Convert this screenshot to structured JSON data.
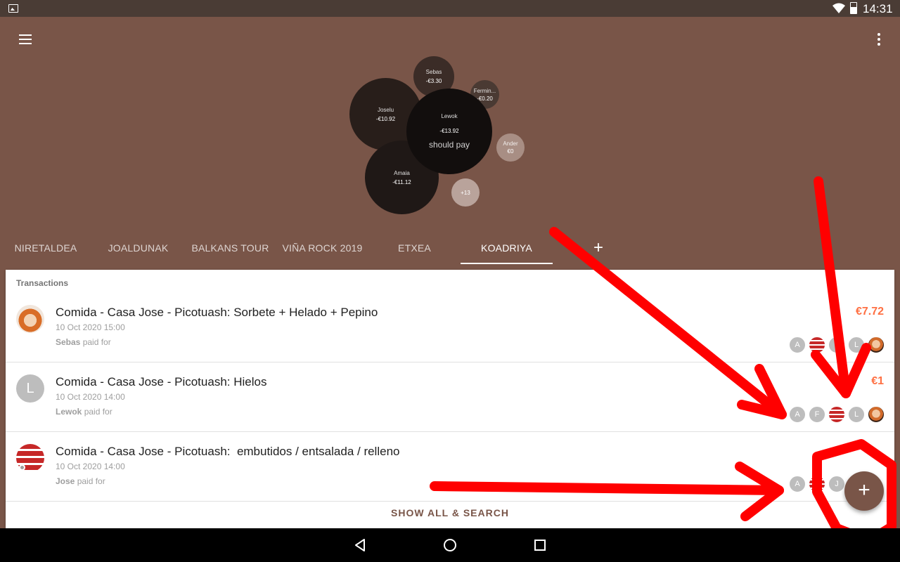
{
  "status_bar": {
    "time": "14:31"
  },
  "summary": {
    "center_label": "should pay",
    "bubbles": [
      {
        "name": "Sebas",
        "value": "-€3.30"
      },
      {
        "name": "Fermin...",
        "value": "-€0.20"
      },
      {
        "name": "Joselu",
        "value": "-€10.92"
      },
      {
        "name": "Lewok",
        "value": "-€13.92"
      },
      {
        "name": "Ander",
        "value": "€0"
      },
      {
        "name": "Amaia",
        "value": "-€11.12"
      },
      {
        "name": "+13",
        "value": ""
      }
    ]
  },
  "tabs": [
    "NIRETALDEA",
    "JOALDUNAK",
    "BALKANS TOUR",
    "VIÑA ROCK 2019",
    "ETXEA",
    "KOADRIYA"
  ],
  "active_tab": "KOADRIYA",
  "add_tab_label": "+",
  "transactions": {
    "title": "Transactions",
    "items": [
      {
        "title": "Comida - Casa Jose - Picotuash: Sorbete + Helado + Pepino",
        "date": "10 Oct 2020 15:00",
        "payer": "Sebas",
        "paid_for": "paid for",
        "amount": "€7.72",
        "participants": [
          "A",
          "banner",
          "",
          "L",
          "photo"
        ]
      },
      {
        "title": "Comida - Casa Jose - Picotuash: Hielos",
        "date": "10 Oct 2020 14:00",
        "payer": "Lewok",
        "paid_for": "paid for",
        "amount": "€1",
        "avatar_letter": "L",
        "participants": [
          "A",
          "F",
          "banner",
          "L",
          "photo"
        ]
      },
      {
        "title": "Comida - Casa Jose - Picotuash:  embutidos / entsalada / relleno",
        "date": "10 Oct 2020 14:00",
        "payer": "Jose",
        "paid_for": "paid for",
        "amount": "",
        "participants": [
          "A",
          "banner",
          "J"
        ]
      }
    ],
    "show_all": "SHOW ALL & SEARCH"
  },
  "fab_label": "+",
  "colors": {
    "primary": "#795548",
    "amount": "#ff7043",
    "annotation": "#ff0000"
  }
}
